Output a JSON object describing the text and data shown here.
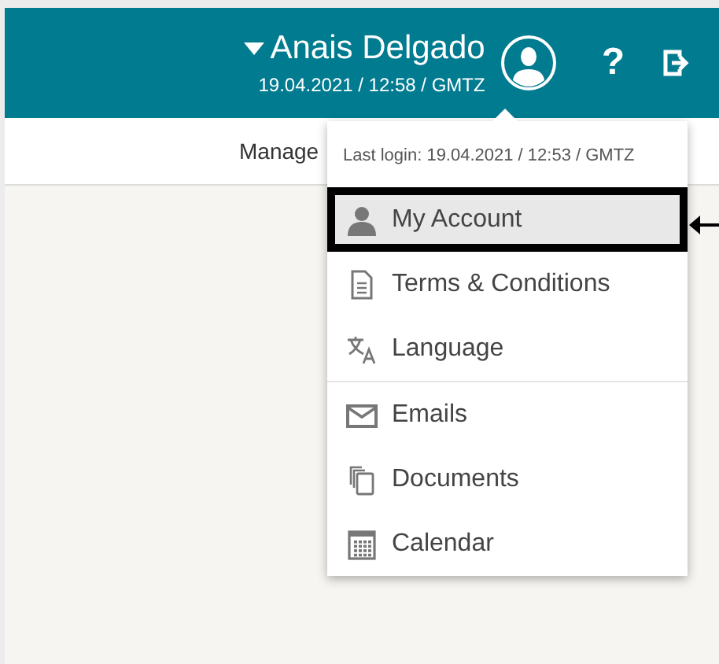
{
  "header": {
    "user_name": "Anais Delgado",
    "datetime": "19.04.2021 / 12:58 / GMTZ",
    "help": "?"
  },
  "subbar": {
    "label": "Manage"
  },
  "user_menu": {
    "last_login": "Last login: 19.04.2021 / 12:53 / GMTZ",
    "groups": [
      {
        "items": [
          {
            "kind": "account",
            "label": "My Account",
            "selected": true
          },
          {
            "kind": "document",
            "label": "Terms & Conditions",
            "selected": false
          },
          {
            "kind": "language",
            "label": "Language",
            "selected": false
          }
        ]
      },
      {
        "items": [
          {
            "kind": "mail",
            "label": "Emails",
            "selected": false
          },
          {
            "kind": "documents",
            "label": "Documents",
            "selected": false
          },
          {
            "kind": "calendar",
            "label": "Calendar",
            "selected": false
          }
        ]
      }
    ]
  }
}
